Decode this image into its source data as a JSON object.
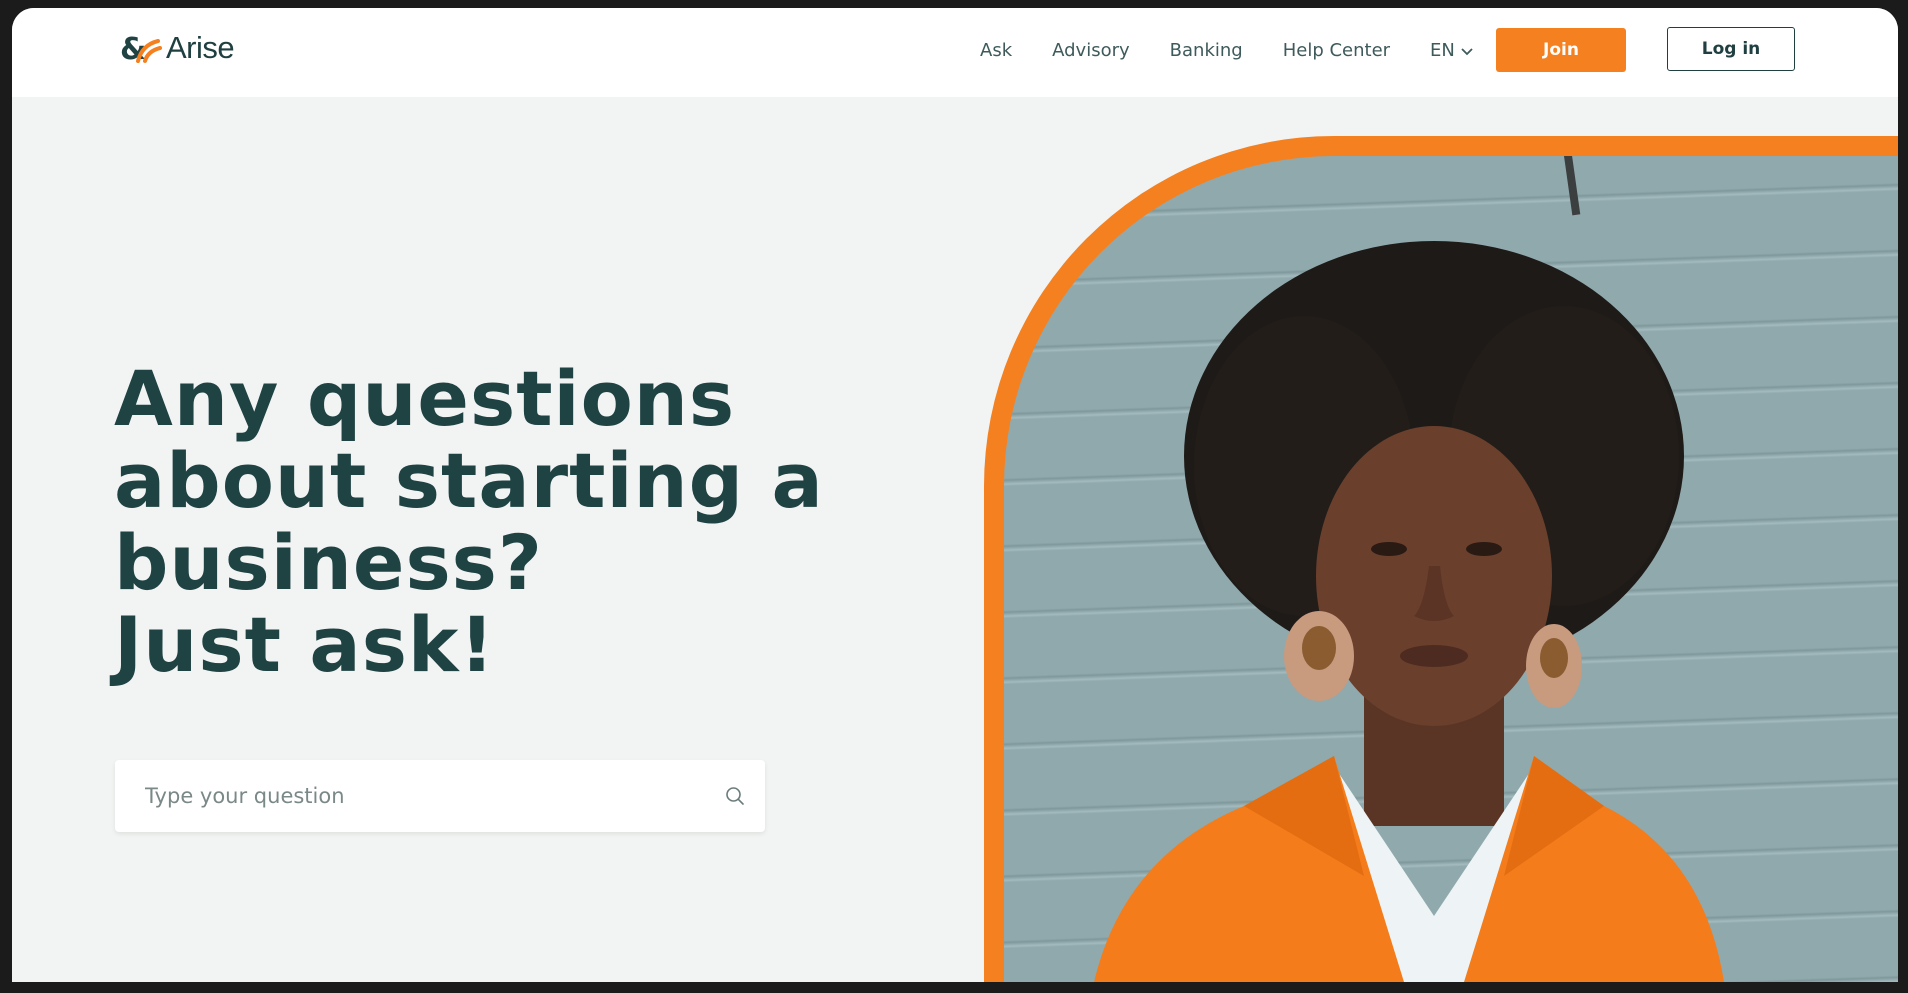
{
  "brand": {
    "logo_text": "Arise",
    "accent": "#f5801f",
    "primary": "#1f4243"
  },
  "nav": {
    "items": [
      "Ask",
      "Advisory",
      "Banking",
      "Help Center"
    ],
    "language": "EN"
  },
  "actions": {
    "join": "Join",
    "login": "Log in"
  },
  "hero": {
    "title_lines": [
      "Any questions",
      "about starting a",
      "business?",
      "Just ask!"
    ]
  },
  "search": {
    "placeholder": "Type your question",
    "icon": "search-icon"
  },
  "image": {
    "description_icon": "portrait-photo"
  }
}
